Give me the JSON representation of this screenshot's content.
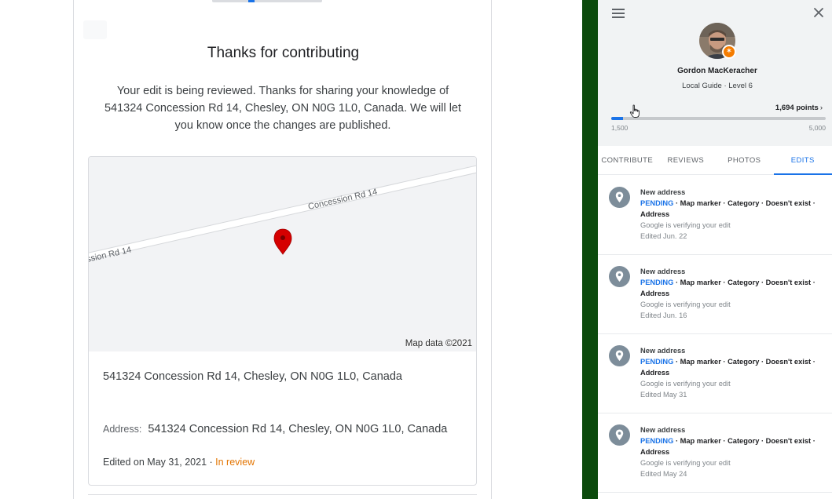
{
  "contribution": {
    "title": "Thanks for contributing",
    "body": "Your edit is being reviewed. Thanks for sharing your knowledge of 541324 Concession Rd 14, Chesley, ON N0G 1L0, Canada. We will let you know once the changes are published.",
    "map": {
      "road_label_right": "Concession Rd 14",
      "road_label_left": "ssion Rd 14",
      "credit": "Map data ©2021"
    },
    "place_name": "541324 Concession Rd 14, Chesley, ON N0G 1L0, Canada",
    "address_label": "Address:",
    "address_value": "541324 Concession Rd 14, Chesley, ON N0G 1L0, Canada",
    "edited_on": "Edited on May 31, 2021",
    "separator": " · ",
    "review_status": "In review"
  },
  "profile": {
    "name": "Gordon MacKeracher",
    "level": "Local Guide · Level 6",
    "points": "1,694 points",
    "points_chevron": "›",
    "range_min": "1,500",
    "range_max": "5,000",
    "progress_fraction": 0.055
  },
  "tabs": [
    {
      "label": "CONTRIBUTE",
      "active": false
    },
    {
      "label": "REVIEWS",
      "active": false
    },
    {
      "label": "PHOTOS",
      "active": false
    },
    {
      "label": "EDITS",
      "active": true
    }
  ],
  "edits": [
    {
      "title": "New address",
      "status": "PENDING",
      "fields_inline": " · Map marker · Category · Doesn't exist ·",
      "fields_last": "Address",
      "note": "Google is verifying your edit",
      "date": "Edited Jun. 22"
    },
    {
      "title": "New address",
      "status": "PENDING",
      "fields_inline": " · Map marker · Category · Doesn't exist ·",
      "fields_last": "Address",
      "note": "Google is verifying your edit",
      "date": "Edited Jun. 16"
    },
    {
      "title": "New address",
      "status": "PENDING",
      "fields_inline": " · Map marker · Category · Doesn't exist ·",
      "fields_last": "Address",
      "note": "Google is verifying your edit",
      "date": "Edited May 31"
    },
    {
      "title": "New address",
      "status": "PENDING",
      "fields_inline": " · Map marker · Category · Doesn't exist ·",
      "fields_last": "Address",
      "note": "Google is verifying your edit",
      "date": "Edited May 24"
    }
  ],
  "icons": {
    "menu": "menu-icon",
    "close": "close-icon",
    "pin": "location-pin-icon",
    "cursor": "hand-cursor-icon"
  },
  "colors": {
    "accent": "#1a73e8",
    "review_status": "#e37400",
    "map_marker": "#d50000",
    "divider_band": "#0b4a0c",
    "badge": "#f57c00"
  }
}
